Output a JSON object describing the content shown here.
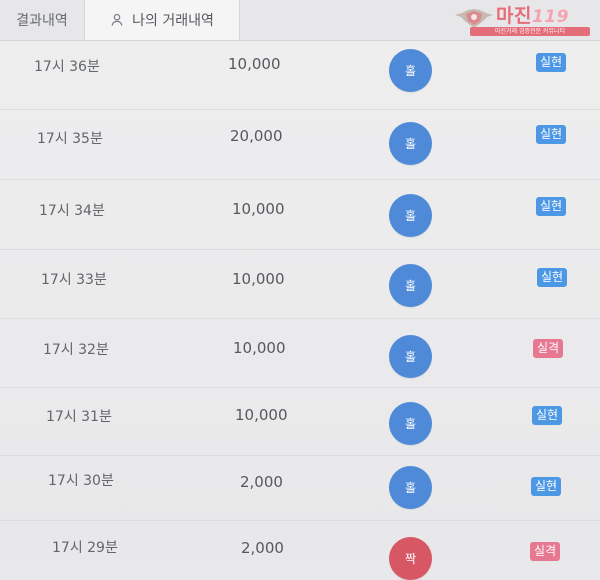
{
  "tabs": {
    "results": "결과내역",
    "mine": "나의 거래내역"
  },
  "watermark": {
    "brand": "마진",
    "brand_number": "119",
    "subtitle": "마진거래 검증전문 커뮤니티"
  },
  "icons": {
    "user_tab": "user-icon",
    "logo": "logo-icon"
  },
  "colors": {
    "pick_blue": "#4f8ad8",
    "pick_red": "#d85765",
    "status_blue": "#4d98e4",
    "status_red": "#e77891"
  },
  "rows": [
    {
      "time": "17시 36분",
      "amount": "10,000",
      "pick": "홀",
      "status": "실현",
      "pick_color": "blue",
      "status_color": "blue"
    },
    {
      "time": "17시 35분",
      "amount": "20,000",
      "pick": "홀",
      "status": "실현",
      "pick_color": "blue",
      "status_color": "blue"
    },
    {
      "time": "17시 34분",
      "amount": "10,000",
      "pick": "홀",
      "status": "실현",
      "pick_color": "blue",
      "status_color": "blue"
    },
    {
      "time": "17시 33분",
      "amount": "10,000",
      "pick": "홀",
      "status": "실현",
      "pick_color": "blue",
      "status_color": "blue"
    },
    {
      "time": "17시 32분",
      "amount": "10,000",
      "pick": "홀",
      "status": "실격",
      "pick_color": "blue",
      "status_color": "red"
    },
    {
      "time": "17시 31분",
      "amount": "10,000",
      "pick": "홀",
      "status": "실현",
      "pick_color": "blue",
      "status_color": "blue"
    },
    {
      "time": "17시 30분",
      "amount": "2,000",
      "pick": "홀",
      "status": "실현",
      "pick_color": "blue",
      "status_color": "blue"
    },
    {
      "time": "17시 29분",
      "amount": "2,000",
      "pick": "짝",
      "status": "실격",
      "pick_color": "red",
      "status_color": "red"
    }
  ]
}
